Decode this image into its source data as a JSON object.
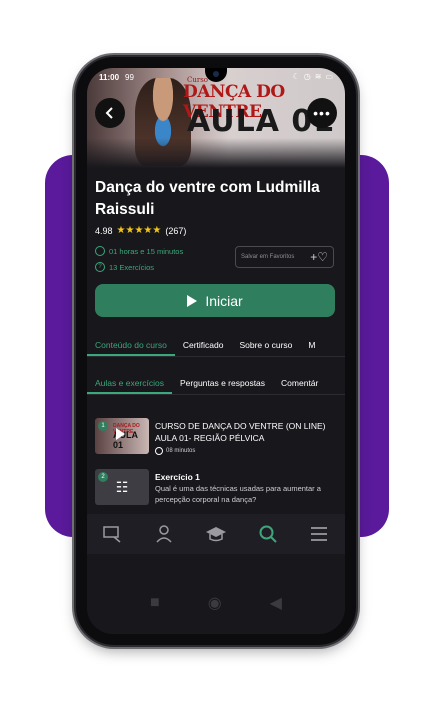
{
  "status_bar": {
    "time": "11:00",
    "signal": "99",
    "icons": [
      "moon-icon",
      "alarm-icon",
      "wifi-icon",
      "battery-icon"
    ]
  },
  "banner": {
    "small_text": "Curso",
    "title_line1": "DANÇA DO VENTRE",
    "title_line2": "AULA 01"
  },
  "course": {
    "title": "Dança do ventre com Ludmilla Raissuli",
    "rating_value": "4.98",
    "stars": 5,
    "rating_count": "(267)",
    "duration": "01 horas e 15 minutos",
    "exercises": "13 Exercícios"
  },
  "favorite": {
    "label": "Salvar em Favoritos",
    "icon": "heart-plus-icon"
  },
  "start_button": {
    "label": "Iniciar"
  },
  "tabs": [
    "Conteúdo do curso",
    "Certificado",
    "Sobre o curso",
    "M"
  ],
  "active_tab": 0,
  "subtabs": [
    "Aulas e exercícios",
    "Perguntas e respostas",
    "Comentár"
  ],
  "active_subtab": 0,
  "lessons": [
    {
      "number": "1",
      "title": "CURSO DE DANÇA DO VENTRE (ON LINE) AULA 01- REGIÃO PÉLVICA",
      "duration": "08 minutos",
      "thumb_title": "DANÇA DO VENTRE",
      "thumb_sub": "AULA 01"
    },
    {
      "number": "2",
      "title": "Exercício 1",
      "subtitle": "Qual é uma das técnicas usadas para aumentar a percepção corporal na dança?"
    }
  ],
  "bottom_nav": [
    "courses-icon",
    "profile-icon",
    "graduation-cap-icon",
    "search-icon",
    "menu-icon"
  ],
  "active_nav": 3,
  "colors": {
    "accent": "#3aa87a",
    "button": "#2f7f5f",
    "purple": "#5a1a9b",
    "stars": "#f5c518"
  }
}
